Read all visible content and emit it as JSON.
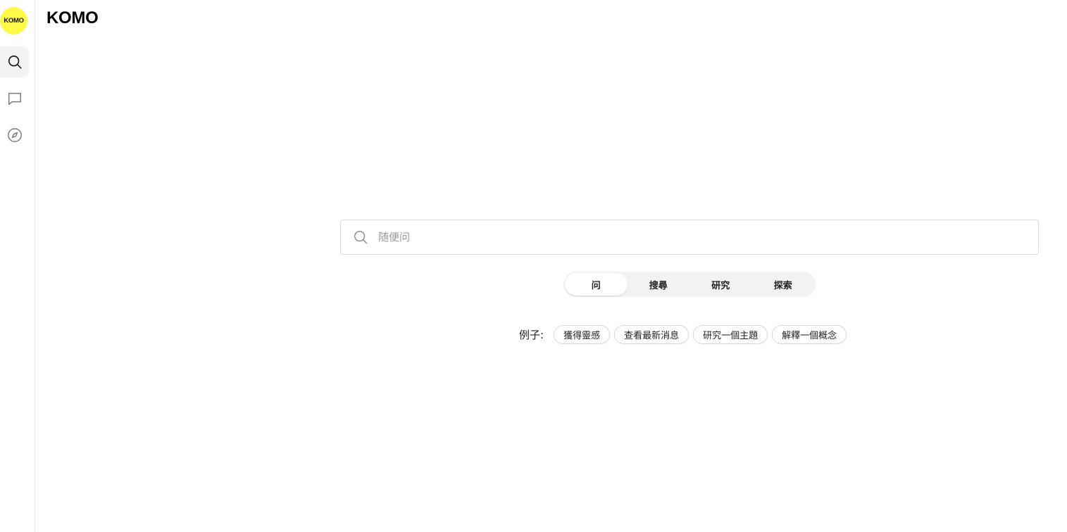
{
  "app": {
    "logo_text": "KOMO",
    "brand": "KOMO",
    "accent_color": "#fff94a"
  },
  "sidebar": {
    "items": [
      {
        "icon": "search-icon",
        "active": true
      },
      {
        "icon": "chat-icon",
        "active": false
      },
      {
        "icon": "compass-icon",
        "active": false
      }
    ]
  },
  "search": {
    "placeholder": "随便问",
    "value": ""
  },
  "modes": {
    "tabs": [
      {
        "label": "问",
        "active": true
      },
      {
        "label": "搜尋",
        "active": false
      },
      {
        "label": "研究",
        "active": false
      },
      {
        "label": "探索",
        "active": false
      }
    ]
  },
  "examples": {
    "label": "例子:",
    "chips": [
      "獲得靈感",
      "查看最新消息",
      "研究一個主題",
      "解釋一個概念"
    ]
  }
}
